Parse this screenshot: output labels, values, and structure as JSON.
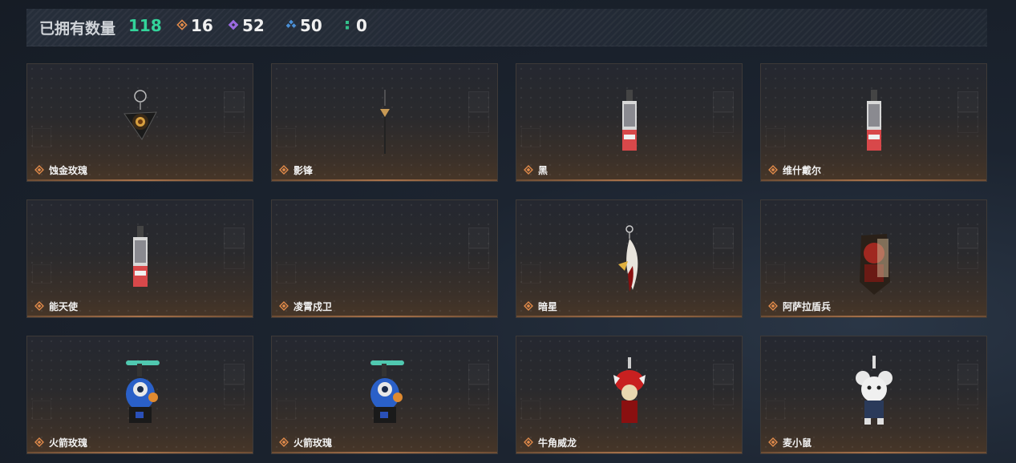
{
  "summary": {
    "owned_label": "已拥有数量",
    "owned_count": "118",
    "stats": [
      {
        "icon": "orange-diamond-icon",
        "value": "16",
        "color": "#e08a4a"
      },
      {
        "icon": "purple-diamond-icon",
        "value": "52",
        "color": "#9a6ae0"
      },
      {
        "icon": "blue-diamond-icon",
        "value": "50",
        "color": "#4a90d8"
      },
      {
        "icon": "green-dots-icon",
        "value": "0",
        "color": "#33c08a"
      }
    ]
  },
  "items": [
    {
      "name": "蚀金玫瑰",
      "rarity": "orange",
      "art": "rose-pendant"
    },
    {
      "name": "影锋",
      "rarity": "orange",
      "art": "blade-pendant"
    },
    {
      "name": "黑",
      "rarity": "orange",
      "art": "card-charm"
    },
    {
      "name": "维什戴尔",
      "rarity": "orange",
      "art": "card-charm"
    },
    {
      "name": "能天使",
      "rarity": "orange",
      "art": "card-charm"
    },
    {
      "name": "凌霄戍卫",
      "rarity": "orange",
      "art": "none"
    },
    {
      "name": "暗星",
      "rarity": "orange",
      "art": "feather-charm"
    },
    {
      "name": "阿萨拉盾兵",
      "rarity": "orange",
      "art": "shield-soldier"
    },
    {
      "name": "火箭玫瑰",
      "rarity": "orange",
      "art": "rocket-figure"
    },
    {
      "name": "火箭玫瑰",
      "rarity": "orange",
      "art": "rocket-figure"
    },
    {
      "name": "牛角威龙",
      "rarity": "orange",
      "art": "horned-figure"
    },
    {
      "name": "麦小鼠",
      "rarity": "orange",
      "art": "mouse-figure"
    }
  ]
}
